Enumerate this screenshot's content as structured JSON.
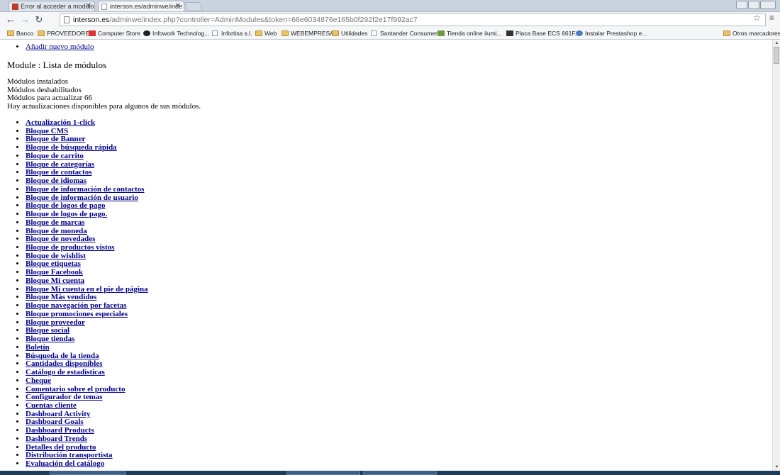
{
  "browser": {
    "tabs": [
      {
        "title": "Error al acceder a modulo",
        "active": false
      },
      {
        "title": "interson.es/adminwe/inde",
        "active": true
      }
    ],
    "url_host": "interson.es",
    "url_path": "/adminwe/index.php?controller=AdminModules&token=66e6034876e165b0f292f2e17f992ac7",
    "bookmarks": [
      "Banco",
      "PROVEEDORES",
      "Computer Store",
      "Infowork Technolog...",
      "Infortisa s.l.",
      "Web",
      "WEBEMPRESA",
      "Utilidades",
      "Santander Consumer",
      "Tienda online ilumi...",
      "Placa Base ECS 661F...",
      "Instalar Prestashop e..."
    ],
    "other_bookmarks": "Otros marcadores"
  },
  "page": {
    "add_module_link": "Añadir nuevo módulo",
    "heading": "Module : Lista de módulos",
    "info": [
      "Módulos instalados",
      "Módulos deshabilitados",
      "Módulos para actualizar 66",
      "Hay actualizaciones disponibles para algunos de sus módulos."
    ],
    "modules": [
      "Actualización 1-click",
      "Bloque CMS",
      "Bloque de Banner",
      "Bloque de búsqueda rápida",
      "Bloque de carrito",
      "Bloque de categorías",
      "Bloque de contactos",
      "Bloque de idiomas",
      "Bloque de información de contactos",
      "Bloque de información de usuario",
      "Bloque de logos de pago",
      "Bloque de logos de pago.",
      "Bloque de marcas",
      "Bloque de moneda",
      "Bloque de novedades",
      "Bloque de productos vistos",
      "Bloque de wishlist",
      "Bloque etiquetas",
      "Bloque Facebook",
      "Bloque Mi cuenta",
      "Bloque Mi cuenta en el pie de página",
      "Bloque Más vendidos",
      "Bloque navegación por facetas",
      "Bloque promociones especiales",
      "Bloque proveedor",
      "Bloque social",
      "Bloque tiendas",
      "Boletín",
      "Búsqueda de la tienda",
      "Cantidades disponibles",
      "Catálogo de estadísticas",
      "Cheque",
      "Comentario sobre el producto",
      "Configurador de temas",
      "Cuentas cliente",
      "Dashboard Activity",
      "Dashboard Goals",
      "Dashboard Products",
      "Dashboard Trends",
      "Detalles del producto",
      "Distribución transportista",
      "Evaluación del catálogo"
    ]
  },
  "colors": {
    "link": "#00008b",
    "chrome": "#c9d3df"
  }
}
